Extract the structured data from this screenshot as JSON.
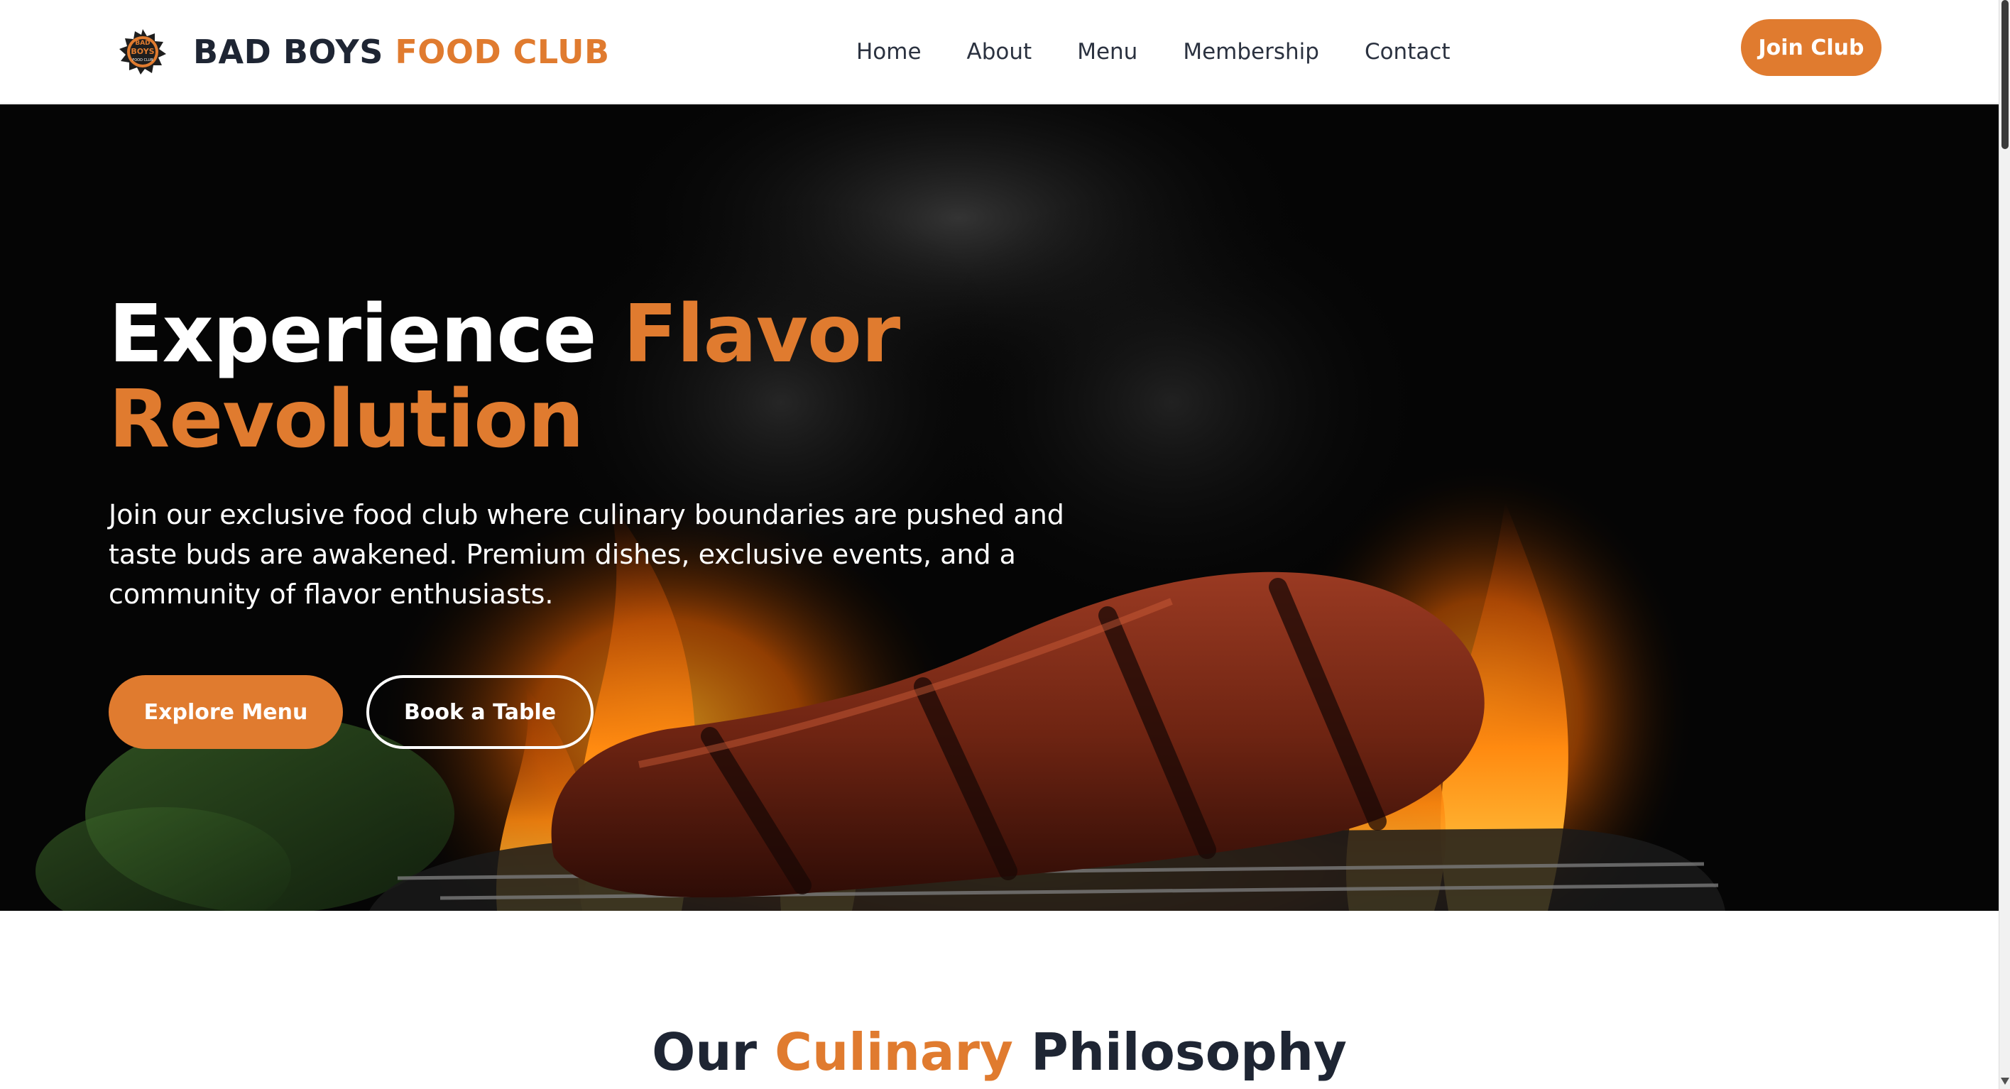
{
  "nav": {
    "brand_main": "BAD BOYS",
    "brand_accent": "FOOD CLUB",
    "logo_text_top": "BAD",
    "logo_text_mid": "BOYS",
    "logo_text_bottom": "FOOD CLUB",
    "links": [
      "Home",
      "About",
      "Menu",
      "Membership",
      "Contact"
    ],
    "cta_label": "Join Club"
  },
  "hero": {
    "title_line1": "Experience",
    "title_accent1": "Flavor",
    "title_accent2": "Revolution",
    "subtitle": "Join our exclusive food club where culinary boundaries are pushed and taste buds are awakened. Premium dishes, exclusive events, and a community of flavor enthusiasts.",
    "primary_button": "Explore Menu",
    "secondary_button": "Book a Table",
    "background_icon": "grilled-steak-flames-image"
  },
  "philosophy": {
    "title_start": "Our",
    "title_accent": "Culinary",
    "title_end": "Philosophy"
  },
  "colors": {
    "accent": "#e07b2f",
    "dark_text": "#1e2533",
    "hero_bg": "#050505"
  }
}
